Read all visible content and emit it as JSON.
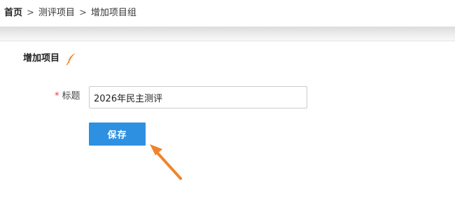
{
  "breadcrumb": {
    "home": "首页",
    "separator": ">",
    "section": "测评项目",
    "current": "增加项目组"
  },
  "form": {
    "heading": "增加项目",
    "heading_icon": "feather-pen-icon",
    "title_field": {
      "required_mark": "*",
      "label": "标题",
      "value": "2026年民主测评"
    },
    "save_label": "保存"
  },
  "annotation": {
    "icon": "arrow-pointer-icon",
    "color": "#f0842a"
  },
  "colors": {
    "primary": "#2e90e0",
    "required": "#e53935",
    "accent": "#f0842a"
  }
}
